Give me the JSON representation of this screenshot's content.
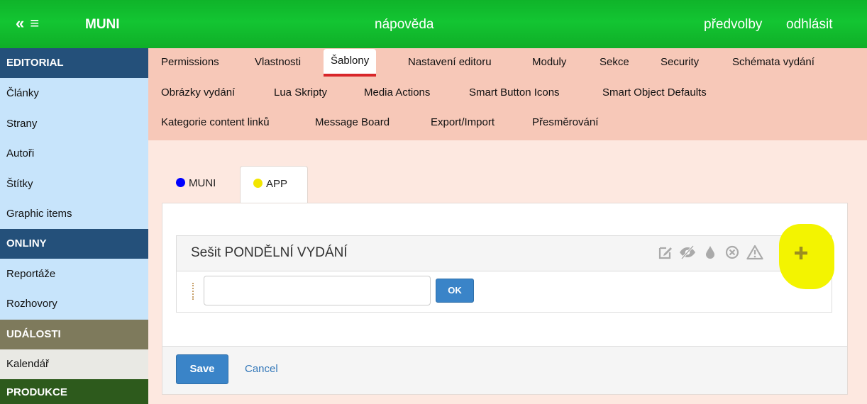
{
  "topbar": {
    "menu_glyph": "« ≡",
    "brand": "MUNI",
    "help": "nápověda",
    "prefs": "předvolby",
    "logout": "odhlásit"
  },
  "sidebar": {
    "items": [
      {
        "label": "EDITORIAL",
        "type": "header"
      },
      {
        "label": "Články"
      },
      {
        "label": "Strany"
      },
      {
        "label": "Autoři"
      },
      {
        "label": "Štítky"
      },
      {
        "label": "Graphic items"
      },
      {
        "label": "ONLINY",
        "type": "header"
      },
      {
        "label": "Reportáže"
      },
      {
        "label": "Rozhovory"
      },
      {
        "label": "UDÁLOSTI",
        "type": "header"
      },
      {
        "label": "Kalendář"
      },
      {
        "label": "PRODUKCE",
        "type": "header"
      }
    ]
  },
  "topnav": {
    "row1": [
      "Permissions",
      "Vlastnosti",
      "Šablony",
      "Nastavení editoru",
      "Moduly",
      "Sekce",
      "Security",
      "Schémata vydání"
    ],
    "row2": [
      "Obrázky vydání",
      "Lua Skripty",
      "Media Actions",
      "Smart Button Icons",
      "Smart Object Defaults"
    ],
    "row3": [
      "Kategorie content linků",
      "Message Board",
      "Export/Import",
      "Přesměrování"
    ],
    "active": "Šablony"
  },
  "tabs": [
    {
      "label": "MUNI",
      "dot_color": "#0000ff"
    },
    {
      "label": "APP",
      "dot_color": "#f2e600",
      "active": true
    }
  ],
  "group": {
    "title": "Sešit PONDĚLNÍ VYDÁNÍ",
    "icons": [
      "edit-icon",
      "visibility-off-icon",
      "color-drop-icon",
      "remove-circle-icon",
      "warning-icon",
      "add-icon"
    ],
    "input_value": "",
    "ok_label": "OK"
  },
  "footer": {
    "save_label": "Save",
    "cancel_label": "Cancel"
  },
  "colors": {
    "topbar": "#13c532",
    "sidebar_bg": "#c7e4fb",
    "sidebar_header": "#24507a",
    "nav_bg": "#f7c8b8",
    "content_bg": "#fde8e0",
    "primary_button": "#3a84c8",
    "highlight": "#f3f400"
  }
}
